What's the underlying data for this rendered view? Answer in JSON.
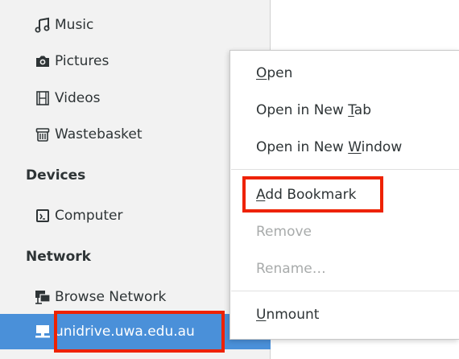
{
  "sidebar": {
    "items": [
      {
        "label": "Music",
        "icon": "music-note-icon"
      },
      {
        "label": "Pictures",
        "icon": "camera-icon"
      },
      {
        "label": "Videos",
        "icon": "film-icon"
      },
      {
        "label": "Wastebasket",
        "icon": "trash-icon"
      }
    ],
    "devices_heading": "Devices",
    "devices": [
      {
        "label": "Computer",
        "icon": "computer-icon"
      }
    ],
    "network_heading": "Network",
    "network": [
      {
        "label": "Browse Network",
        "icon": "network-icon"
      },
      {
        "label": "unidrive.uwa.edu.au",
        "icon": "network-drive-icon",
        "selected": true
      }
    ]
  },
  "context_menu": {
    "items": [
      {
        "label": "Open",
        "mnemonic_index": 0,
        "enabled": true
      },
      {
        "label": "Open in New Tab",
        "mnemonic_index": 12,
        "enabled": true
      },
      {
        "label": "Open in New Window",
        "mnemonic_index": 12,
        "enabled": true
      },
      {
        "label": "Add Bookmark",
        "mnemonic_index": 0,
        "enabled": true
      },
      {
        "label": "Remove",
        "enabled": false
      },
      {
        "label": "Rename…",
        "enabled": false
      },
      {
        "label": "Unmount",
        "mnemonic_index": 0,
        "enabled": true
      }
    ]
  },
  "colors": {
    "selection": "#4a90d9",
    "highlight_box": "#ee2200",
    "disabled_text": "#a8abab"
  }
}
